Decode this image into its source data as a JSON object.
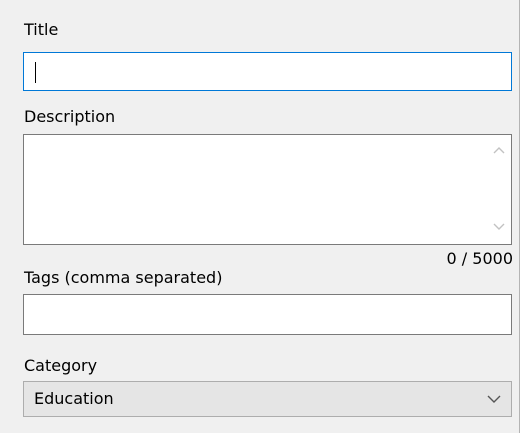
{
  "form": {
    "title_label": "Title",
    "title_value": "",
    "description_label": "Description",
    "description_value": "",
    "char_counter": "0 / 5000",
    "tags_label": "Tags (comma separated)",
    "tags_value": "",
    "category_label": "Category",
    "category_selected": "Education"
  },
  "icons": {
    "scroll_up": "chevron-up-icon",
    "scroll_down": "chevron-down-icon",
    "dropdown": "chevron-down-icon"
  },
  "colors": {
    "panel_bg": "#f0f0f0",
    "focus_border": "#0078d7",
    "input_border": "#7a7a7a",
    "combo_bg": "#e5e5e5"
  }
}
